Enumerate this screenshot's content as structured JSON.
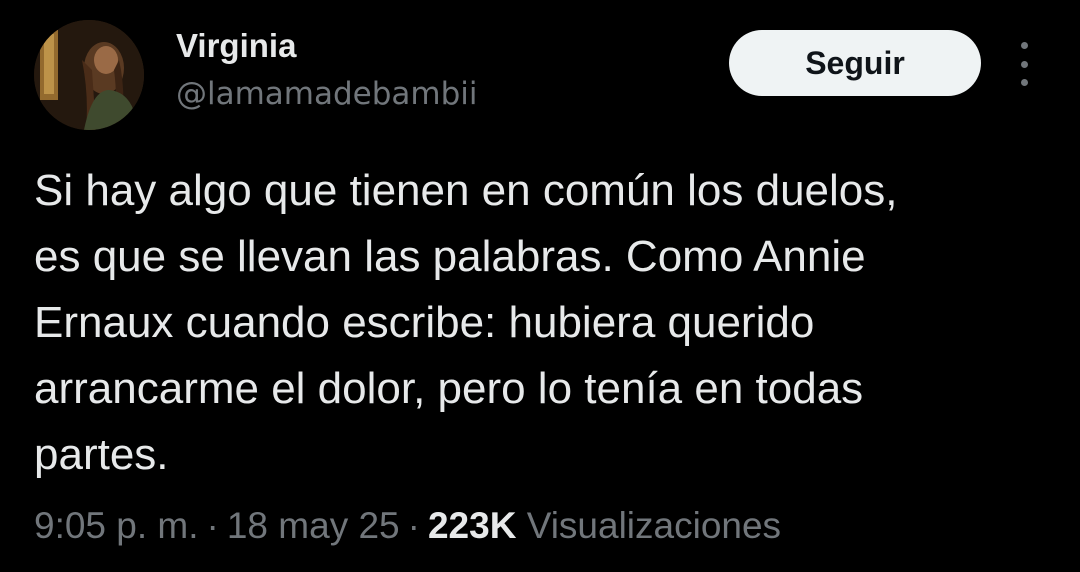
{
  "user": {
    "display_name": "Virginia",
    "handle": "@lamamadebambii"
  },
  "follow_button": {
    "label": "Seguir"
  },
  "more_menu": {
    "icon": "more-vertical-icon"
  },
  "tweet": {
    "text": "Si hay algo que tienen en común los duelos,\nes que se llevan las palabras. Como Annie\nErnaux cuando escribe: hubiera querido\narrancarme el dolor, pero lo tenía en todas\npartes."
  },
  "meta": {
    "time": "9:05 p. m.",
    "separator": "·",
    "date": "18 may 25",
    "views_count": "223K",
    "views_label": "Visualizaciones"
  },
  "colors": {
    "background": "#000000",
    "primary_text": "#e7e9ea",
    "secondary_text": "#71767b",
    "button_bg": "#eff3f4",
    "button_text": "#0f1419"
  }
}
